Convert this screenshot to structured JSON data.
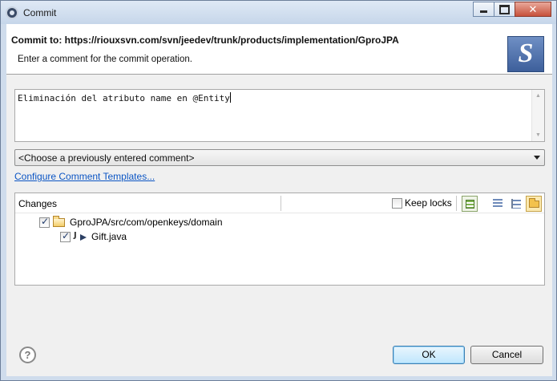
{
  "window": {
    "title": "Commit"
  },
  "banner": {
    "title": "Commit to: https://riouxsvn.com/svn/jeedev/trunk/products/implementation/GproJPA",
    "description": "Enter a comment for the commit operation."
  },
  "comment": {
    "value": "Eliminación del atributo name en @Entity"
  },
  "previous_comments": {
    "selected": "<Choose a previously entered comment>"
  },
  "templates_link": {
    "label": "Configure Comment Templates..."
  },
  "changes": {
    "header": "Changes",
    "keep_locks": {
      "label": "Keep locks",
      "checked": false
    },
    "tree": [
      {
        "label": "GproJPA/src/com/openkeys/domain",
        "type": "folder",
        "checked": true
      },
      {
        "label": "Gift.java",
        "type": "java-file",
        "checked": true
      }
    ]
  },
  "buttons": {
    "ok": "OK",
    "cancel": "Cancel",
    "help": "?"
  }
}
